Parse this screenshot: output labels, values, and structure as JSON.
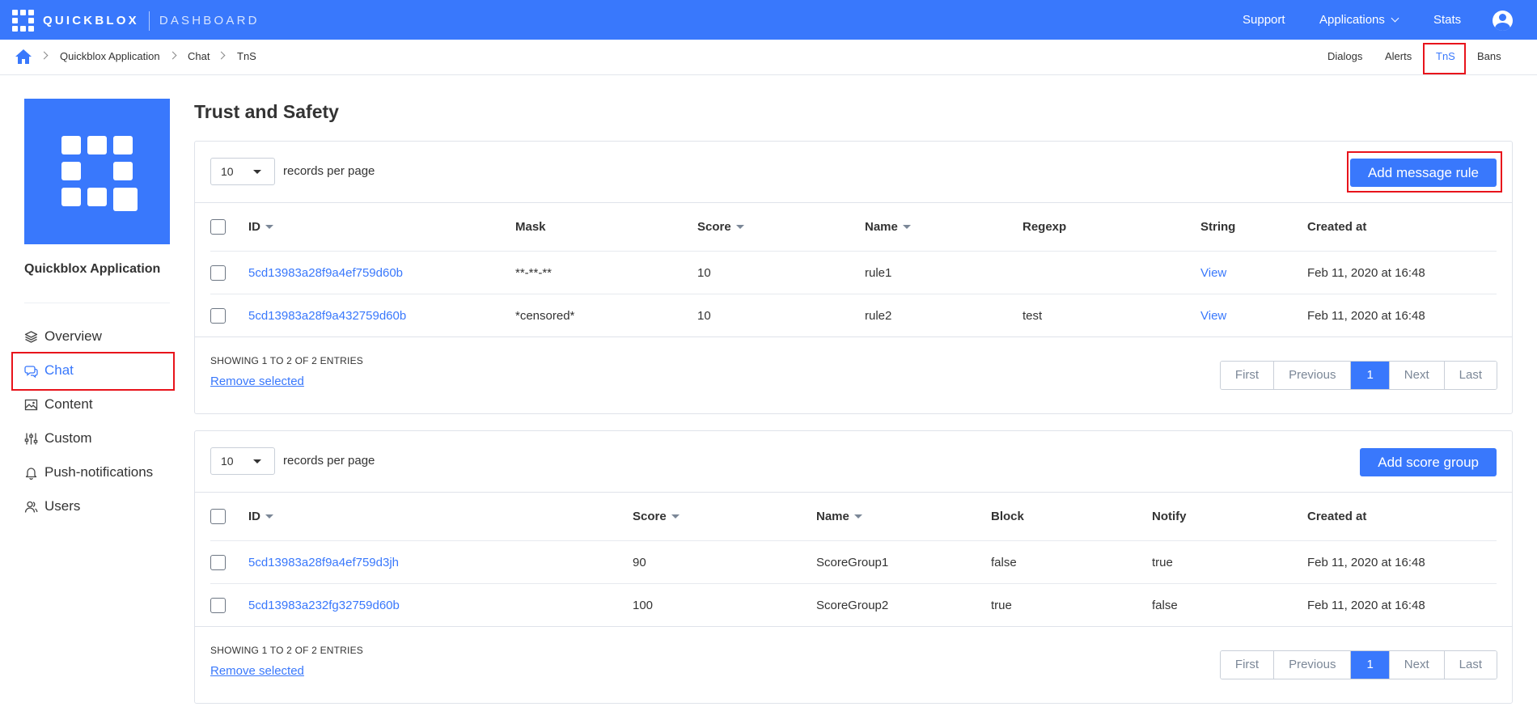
{
  "topbar": {
    "logo_text": "QUICKBLOX",
    "logo_sub": "DASHBOARD",
    "support": "Support",
    "applications": "Applications",
    "stats": "Stats"
  },
  "breadcrumb": {
    "items": [
      "Quickblox Application",
      "Chat",
      "TnS"
    ],
    "subnav": [
      "Dialogs",
      "Alerts",
      "TnS",
      "Bans"
    ]
  },
  "sidebar": {
    "app_name": "Quickblox Application",
    "items": [
      {
        "label": "Overview",
        "icon": "layers-icon"
      },
      {
        "label": "Chat",
        "icon": "chat-icon"
      },
      {
        "label": "Content",
        "icon": "image-icon"
      },
      {
        "label": "Custom",
        "icon": "sliders-icon"
      },
      {
        "label": "Push-notifications",
        "icon": "bell-icon"
      },
      {
        "label": "Users",
        "icon": "users-icon"
      }
    ],
    "active": "Chat"
  },
  "page": {
    "title": "Trust and Safety"
  },
  "rules": {
    "per_page": "10",
    "per_page_label": "records per page",
    "add_button": "Add message rule",
    "columns": [
      "ID",
      "Mask",
      "Score",
      "Name",
      "Regexp",
      "String",
      "Created at"
    ],
    "rows": [
      {
        "id": "5cd13983a28f9a4ef759d60b",
        "mask": "**-**-**",
        "score": "10",
        "name": "rule1",
        "regexp": "",
        "string": "View",
        "created": "Feb 11, 2020 at 16:48"
      },
      {
        "id": "5cd13983a28f9a432759d60b",
        "mask": "*censored*",
        "score": "10",
        "name": "rule2",
        "regexp": "test",
        "string": "View",
        "created": "Feb 11, 2020 at 16:48"
      }
    ],
    "showing": "SHOWING 1 TO 2 OF 2 ENTRIES",
    "remove": "Remove selected",
    "pager": [
      "First",
      "Previous",
      "1",
      "Next",
      "Last"
    ]
  },
  "groups": {
    "per_page": "10",
    "per_page_label": "records per page",
    "add_button": "Add score group",
    "columns": [
      "ID",
      "Score",
      "Name",
      "Block",
      "Notify",
      "Created at"
    ],
    "rows": [
      {
        "id": "5cd13983a28f9a4ef759d3jh",
        "score": "90",
        "name": "ScoreGroup1",
        "block": "false",
        "notify": "true",
        "created": "Feb 11, 2020 at 16:48"
      },
      {
        "id": "5cd13983a232fg32759d60b",
        "score": "100",
        "name": "ScoreGroup2",
        "block": "true",
        "notify": "false",
        "created": "Feb 11, 2020 at 16:48"
      }
    ],
    "showing": "SHOWING 1 TO 2 OF 2 ENTRIES",
    "remove": "Remove selected",
    "pager": [
      "First",
      "Previous",
      "1",
      "Next",
      "Last"
    ]
  },
  "colors": {
    "brand": "#3978fc",
    "highlight": "#e8141b"
  }
}
